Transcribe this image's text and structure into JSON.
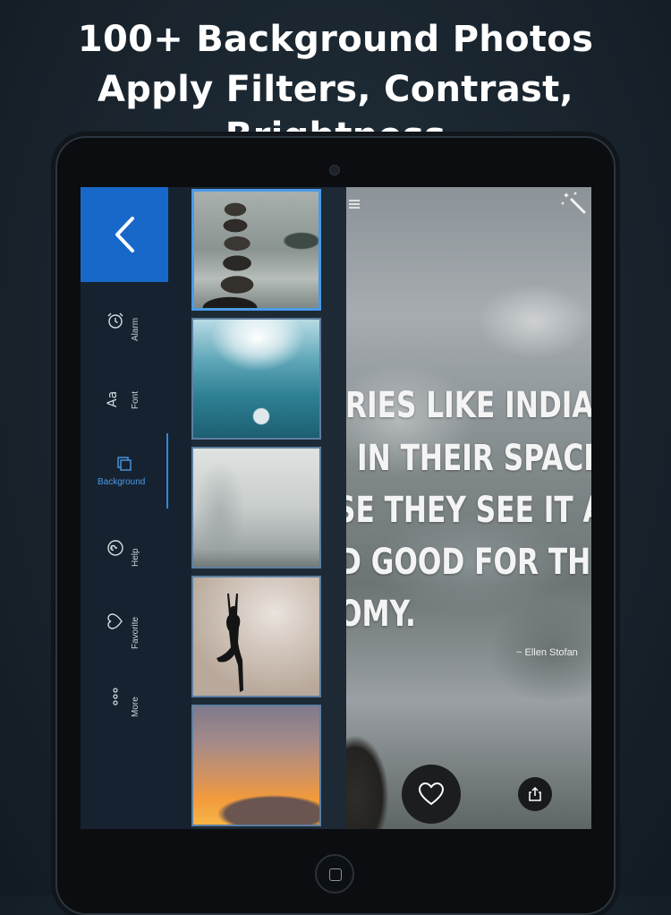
{
  "headline": {
    "line1": "100+ Background Photos",
    "line2": "Apply Filters, Contrast, Brightness"
  },
  "nav": {
    "back_icon": "chevron-left-icon",
    "items": [
      {
        "label": "Alarm",
        "icon": "alarm-clock-icon"
      },
      {
        "label": "Font",
        "icon": "font-aa-icon"
      },
      {
        "label": "Background",
        "icon": "layers-icon",
        "active": true
      },
      {
        "label": "Help",
        "icon": "help-icon"
      },
      {
        "label": "Favorite",
        "icon": "heart-icon"
      },
      {
        "label": "More",
        "icon": "more-dots-icon"
      }
    ],
    "font_icon_text": "Aa"
  },
  "thumbnails": [
    {
      "subject": "stacked stones by misty river",
      "selected": true
    },
    {
      "subject": "sunlight under water"
    },
    {
      "subject": "foggy forest"
    },
    {
      "subject": "yoga silhouette"
    },
    {
      "subject": "sunset sky over hills"
    }
  ],
  "quote": {
    "lines": [
      "RIES LIKE INDIA",
      "IN THEIR SPACE",
      "SE THEY SEE IT AS",
      "D GOOD FOR THEIR",
      "OMY."
    ],
    "author": "~ Ellen Stofan"
  },
  "colors": {
    "accent": "#1868c9",
    "active_label": "#4a9ae8",
    "nav_bg": "#172230"
  }
}
